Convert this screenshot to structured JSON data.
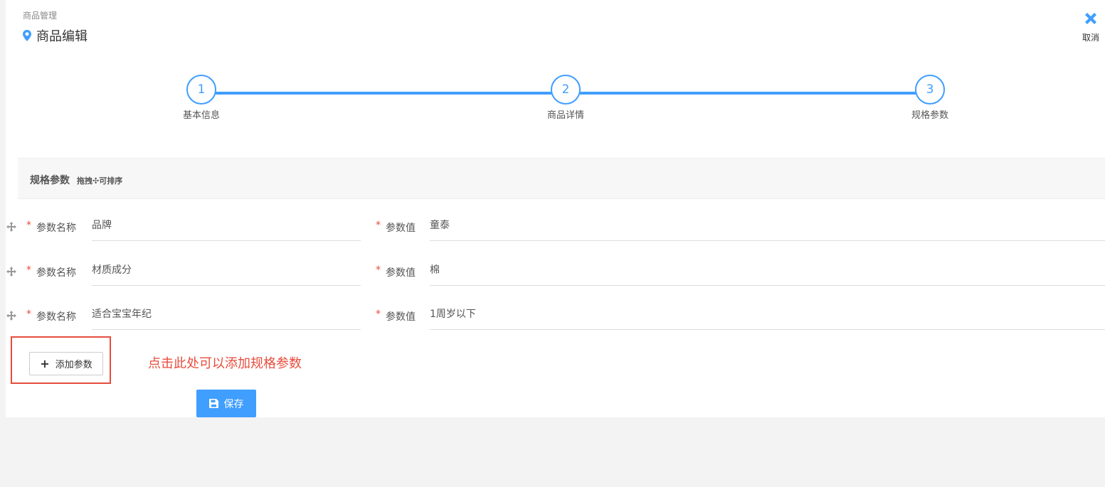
{
  "breadcrumb": "商品管理",
  "page_title": "商品编辑",
  "cancel_label": "取消",
  "steps": [
    {
      "number": "1",
      "label": "基本信息"
    },
    {
      "number": "2",
      "label": "商品详情"
    },
    {
      "number": "3",
      "label": "规格参数"
    }
  ],
  "section": {
    "title": "规格参数",
    "hint": "拖拽✣可排序"
  },
  "params": [
    {
      "name_label": "参数名称",
      "name": "品牌",
      "value_label": "参数值",
      "value": "童泰"
    },
    {
      "name_label": "参数名称",
      "name": "材质成分",
      "value_label": "参数值",
      "value": "棉"
    },
    {
      "name_label": "参数名称",
      "name": "适合宝宝年纪",
      "value_label": "参数值",
      "value": "1周岁以下"
    }
  ],
  "required_mark": "*",
  "add_param_label": "添加参数",
  "annotation": "点击此处可以添加规格参数",
  "save_label": "保存",
  "colors": {
    "accent": "#409eff",
    "annotation": "#e74c3c",
    "required": "#e74c3c"
  }
}
